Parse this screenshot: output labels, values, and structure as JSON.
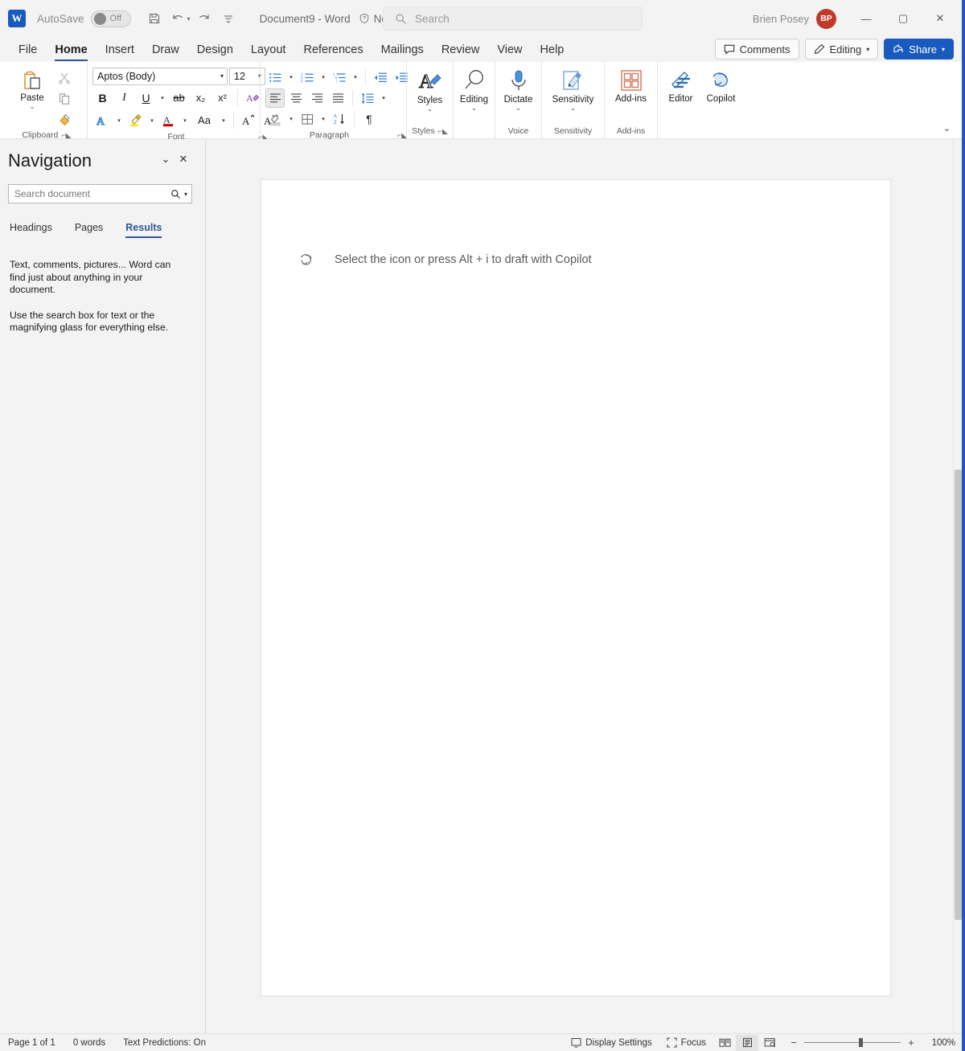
{
  "titlebar": {
    "app_logo": "word-logo",
    "autosave_label": "AutoSave",
    "autosave_state": "Off",
    "save_icon": "save-icon",
    "undo_icon": "undo-icon",
    "redo_icon": "redo-icon",
    "customize_qat_icon": "customize-quick-access-toolbar-icon",
    "document_title": "Document9  -  Word",
    "sensitivity_label": "No Label",
    "user_name": "Brien Posey",
    "avatar_initials": "BP",
    "minimize": "—",
    "maximize": "▢",
    "close": "✕"
  },
  "search": {
    "placeholder": "Search",
    "icon": "search-icon"
  },
  "ribbon_tabs": {
    "items": [
      {
        "label": "File",
        "active": false
      },
      {
        "label": "Home",
        "active": true
      },
      {
        "label": "Insert",
        "active": false
      },
      {
        "label": "Draw",
        "active": false
      },
      {
        "label": "Design",
        "active": false
      },
      {
        "label": "Layout",
        "active": false
      },
      {
        "label": "References",
        "active": false
      },
      {
        "label": "Mailings",
        "active": false
      },
      {
        "label": "Review",
        "active": false
      },
      {
        "label": "View",
        "active": false
      },
      {
        "label": "Help",
        "active": false
      }
    ],
    "comments_label": "Comments",
    "editing_label": "Editing",
    "share_label": "Share"
  },
  "ribbon": {
    "groups": [
      {
        "name": "Clipboard",
        "label": "Clipboard"
      },
      {
        "name": "Font",
        "label": "Font"
      },
      {
        "name": "Paragraph",
        "label": "Paragraph"
      },
      {
        "name": "Styles",
        "label": "Styles"
      },
      {
        "name": "Voice",
        "label": "Voice"
      },
      {
        "name": "Sensitivity",
        "label": "Sensitivity"
      },
      {
        "name": "Add-ins",
        "label": "Add-ins"
      }
    ],
    "clipboard": {
      "paste_label": "Paste",
      "cut_icon": "cut-icon",
      "copy_icon": "copy-icon",
      "format_painter_icon": "format-painter-icon"
    },
    "font": {
      "font_name": "Aptos (Body)",
      "font_size": "12",
      "bold": "B",
      "italic": "I",
      "underline": "U",
      "strikethrough": "ab",
      "subscript": "x₂",
      "superscript": "x²",
      "clear_formatting": "clear-formatting-icon",
      "text_effects": "text-effects-icon",
      "highlight": "text-highlight-color-icon",
      "font_color": "font-color-icon",
      "change_case": "Aa",
      "grow_font": "A",
      "shrink_font": "A"
    },
    "paragraph": {
      "bullets": "bullets-icon",
      "numbering": "numbering-icon",
      "multilevel": "multilevel-list-icon",
      "decrease_indent": "decrease-indent-icon",
      "increase_indent": "increase-indent-icon",
      "align_left": "align-left-icon",
      "align_center": "align-center-icon",
      "align_right": "align-right-icon",
      "justify": "justify-icon",
      "line_spacing": "line-spacing-icon",
      "shading": "shading-icon",
      "borders": "borders-icon",
      "sort": "sort-icon",
      "show_marks": "¶"
    },
    "styles_label": "Styles",
    "editing_label": "Editing",
    "dictate_label": "Dictate",
    "sensitivity_label": "Sensitivity",
    "addins_label": "Add-ins",
    "editor_label": "Editor",
    "copilot_label": "Copilot",
    "collapse_icon": "collapse-ribbon-icon"
  },
  "navigation": {
    "title": "Navigation",
    "collapse_icon": "chevron-down-icon",
    "close_icon": "close-icon",
    "search_placeholder": "Search document",
    "search_icon": "magnifying-glass-icon",
    "search_dropdown_icon": "chevron-down-icon",
    "tabs": [
      {
        "label": "Headings",
        "active": false
      },
      {
        "label": "Pages",
        "active": false
      },
      {
        "label": "Results",
        "active": true
      }
    ],
    "body": [
      "Text, comments, pictures... Word can find just about anything in your document.",
      "Use the search box for text or the magnifying glass for everything else."
    ]
  },
  "document": {
    "copilot_icon": "copilot-draft-icon",
    "copilot_prompt": "Select the icon or press Alt + i to draft with Copilot"
  },
  "statusbar": {
    "page_info": "Page 1 of 1",
    "word_count": "0 words",
    "text_predictions": "Text Predictions: On",
    "display_settings": "Display Settings",
    "display_settings_icon": "display-settings-icon",
    "focus": "Focus",
    "focus_icon": "focus-icon",
    "read_mode_icon": "read-mode-icon",
    "print_layout_icon": "print-layout-icon",
    "web_layout_icon": "web-layout-icon",
    "zoom_out": "−",
    "zoom_in": "+",
    "zoom_level": "100%"
  },
  "colors": {
    "accent_blue": "#185abd",
    "tab_underline": "#2b579a",
    "avatar_red": "#c0392b",
    "window_border": "#185abd"
  }
}
